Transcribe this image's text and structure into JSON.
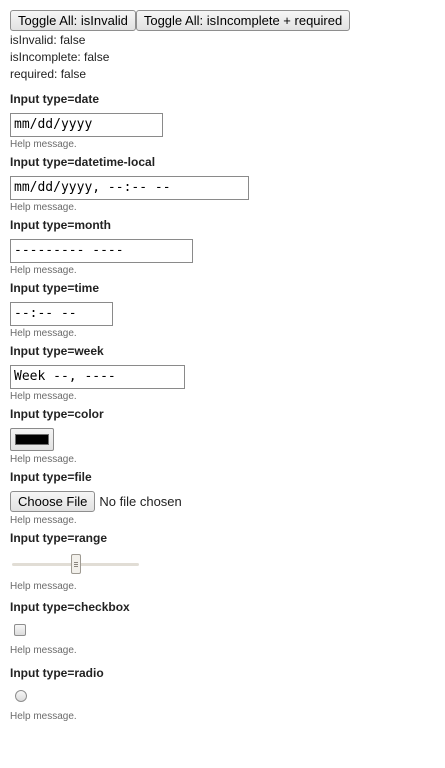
{
  "toolbar": {
    "toggle_invalid_label": "Toggle All: isInvalid",
    "toggle_incomplete_label": "Toggle All: isIncomplete + required"
  },
  "status": {
    "isInvalid": "isInvalid: false",
    "isIncomplete": "isIncomplete: false",
    "required": "required: false"
  },
  "fields": [
    {
      "label": "Input type=date",
      "value": "mm/dd/yyyy",
      "help": "Help message."
    },
    {
      "label": "Input type=datetime-local",
      "value": "mm/dd/yyyy, --:-- --",
      "help": "Help message."
    },
    {
      "label": "Input type=month",
      "value": "--------- ----",
      "help": "Help message."
    },
    {
      "label": "Input type=time",
      "value": "--:-- --",
      "help": "Help message."
    },
    {
      "label": "Input type=week",
      "value": "Week --, ----",
      "help": "Help message."
    },
    {
      "label": "Input type=color",
      "value": "#000000",
      "help": "Help message."
    },
    {
      "label": "Input type=file",
      "button": "Choose File",
      "value": "No file chosen",
      "help": "Help message."
    },
    {
      "label": "Input type=range",
      "value": 0.5,
      "help": "Help message."
    },
    {
      "label": "Input type=checkbox",
      "checked": false,
      "help": "Help message."
    },
    {
      "label": "Input type=radio",
      "checked": false,
      "help": "Help message."
    }
  ]
}
